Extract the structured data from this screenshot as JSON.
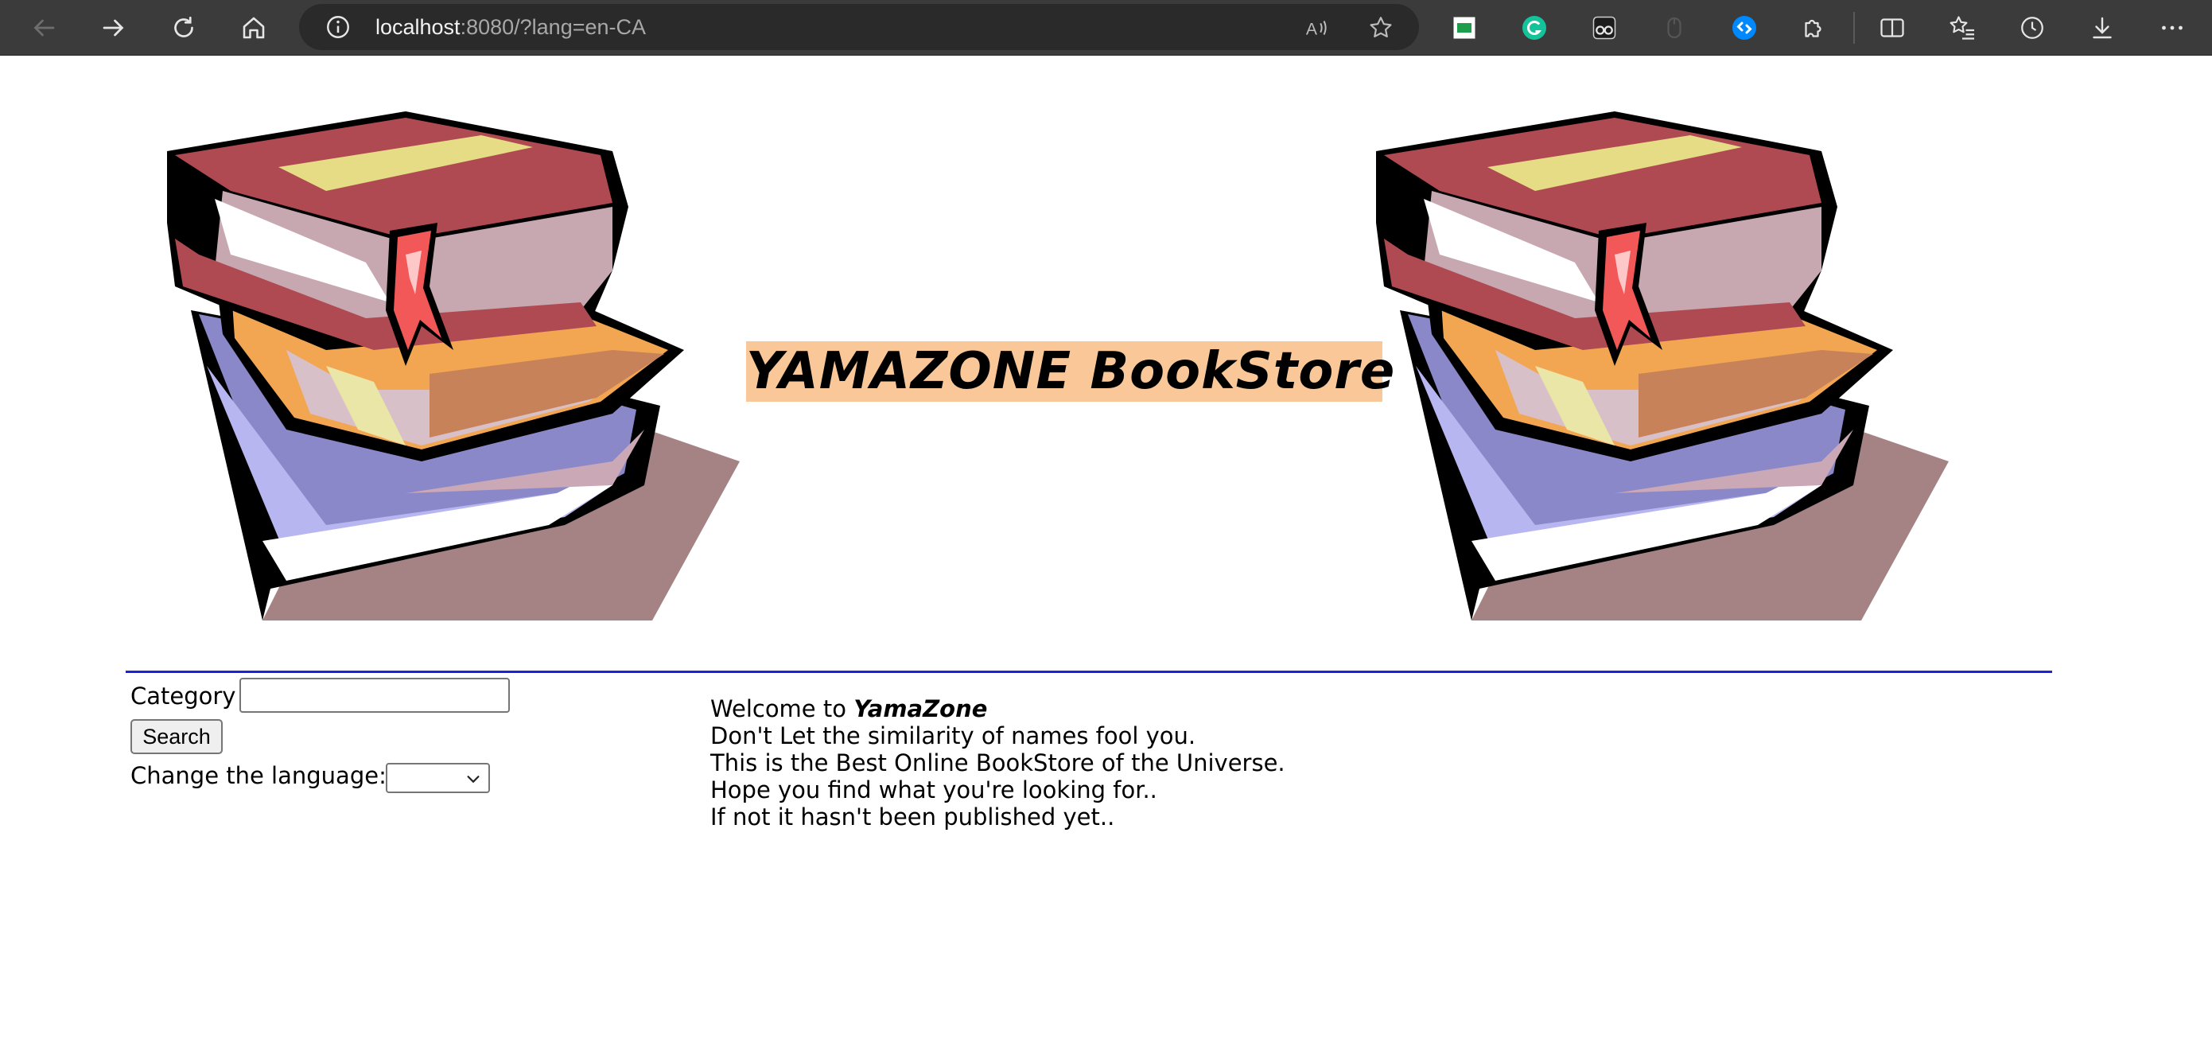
{
  "browser": {
    "url_host": "localhost",
    "url_rest": ":8080/?lang=en-CA",
    "icons": {
      "back": "back-arrow-icon",
      "forward": "forward-arrow-icon",
      "refresh": "refresh-icon",
      "home": "home-icon",
      "site_info": "info-icon",
      "read_aloud": "read-aloud-icon",
      "favorite": "star-icon",
      "extensions": [
        "extension-green-icon",
        "grammarly-icon",
        "extension-glasses-icon",
        "extension-mouse-icon",
        "shazam-icon"
      ],
      "puzzle": "puzzle-icon",
      "split_screen": "split-screen-icon",
      "favorites": "favorites-icon",
      "history": "history-icon",
      "downloads": "download-icon",
      "more": "more-icon"
    }
  },
  "page": {
    "title": "YAMAZONE BookStore",
    "title_bg": "#fac898",
    "rule_color": "#1f1fe0",
    "sidebar": {
      "category_label": "Category",
      "category_value": "",
      "search_label": "Search",
      "language_label": "Change the language:",
      "language_selected": ""
    },
    "welcome": {
      "intro": "Welcome to ",
      "brand": "YamaZone",
      "lines": [
        "Don't Let the similarity of names fool you.",
        "This is the Best Online BookStore of the Universe.",
        "Hope you find what you're looking for..",
        "If not it hasn't been published yet.."
      ]
    }
  }
}
